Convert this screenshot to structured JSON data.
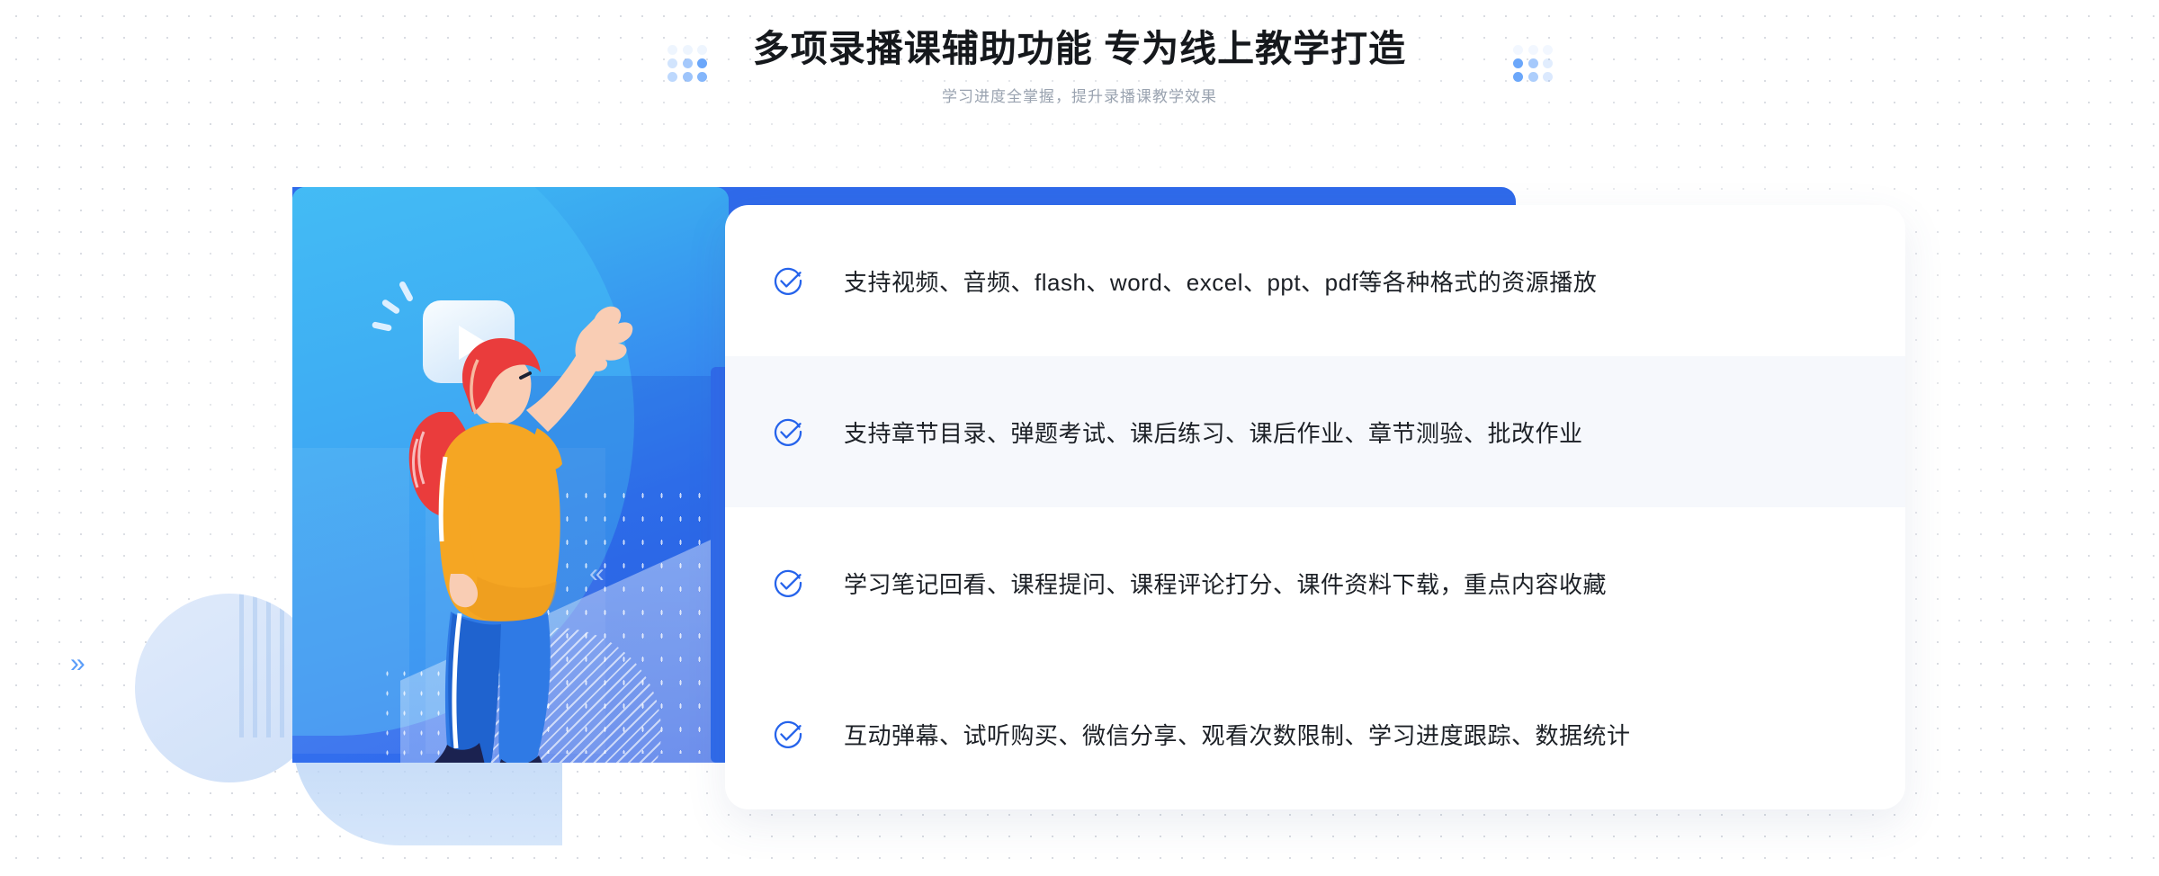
{
  "header": {
    "title": "多项录播课辅助功能 专为线上教学打造",
    "subtitle": "学习进度全掌握，提升录播课教学效果",
    "decor_left_icon": "dot-grid-decoration",
    "decor_right_icon": "dot-grid-decoration"
  },
  "illustration": {
    "name": "online-learning-illustration",
    "play_icon": "play-button-icon",
    "character": "woman-pointing-up-illustration",
    "chevron_left_icon": "chevron-double-left-icon",
    "chevron_right_icon": "chevron-double-right-icon",
    "chevron_right_glyph": "»",
    "chevron_left_glyph": "«"
  },
  "colors": {
    "accent_blue": "#2f6aea",
    "check_blue": "#2563eb",
    "panel_cyan": "#3fbdf4",
    "panel_blue": "#2f63ea",
    "title_dark": "#15181c",
    "subtitle_gray": "#9aa3b0",
    "active_row_bg": "#f6f8fc"
  },
  "features": [
    {
      "icon": "check-circle-icon",
      "text": "支持视频、音频、flash、word、excel、ppt、pdf等各种格式的资源播放",
      "active": false
    },
    {
      "icon": "check-circle-icon",
      "text": "支持章节目录、弹题考试、课后练习、课后作业、章节测验、批改作业",
      "active": true
    },
    {
      "icon": "check-circle-icon",
      "text": "学习笔记回看、课程提问、课程评论打分、课件资料下载，重点内容收藏",
      "active": false
    },
    {
      "icon": "check-circle-icon",
      "text": "互动弹幕、试听购买、微信分享、观看次数限制、学习进度跟踪、数据统计",
      "active": false
    }
  ]
}
